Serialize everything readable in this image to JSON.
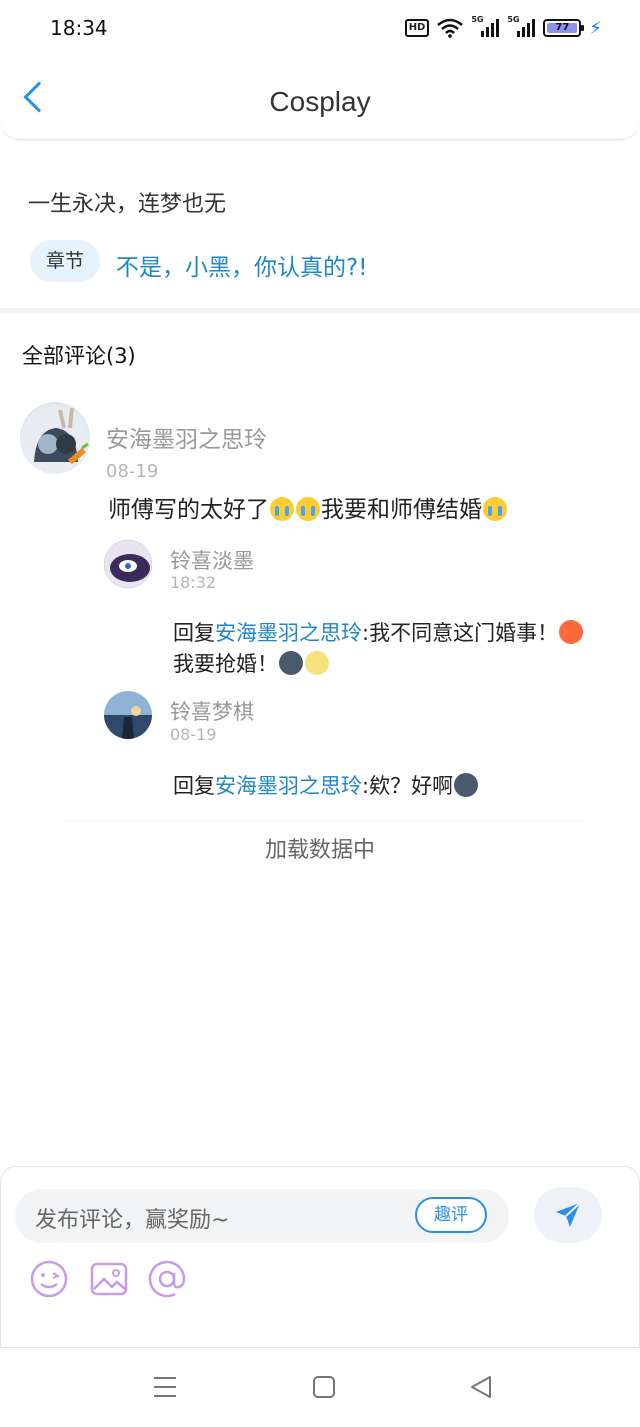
{
  "status_bar": {
    "time": "18:34",
    "hd_label": "HD",
    "signal_label": "5G",
    "battery": "77"
  },
  "header": {
    "title": "Cosplay"
  },
  "book": {
    "title": "一生永决，连梦也无",
    "chapter_tag": "章节",
    "chapter_name": "不是，小黑，你认真的?!"
  },
  "comments": {
    "heading": "全部评论(3)",
    "main": {
      "user": "安海墨羽之思玲",
      "date": "08-19",
      "text_part1": "师傅写的太好了",
      "text_part2": "我要和师傅结婚"
    },
    "replies": [
      {
        "user": "铃喜淡墨",
        "time": "18:32",
        "prefix": "回复",
        "target": "安海墨羽之思玲",
        "text_line1": ":我不同意这门婚事！",
        "text_line2": "我要抢婚！"
      },
      {
        "user": "铃喜梦棋",
        "time": "08-19",
        "prefix": "回复",
        "target": "安海墨羽之思玲",
        "text": ":欸？好啊"
      }
    ],
    "loading": "加载数据中"
  },
  "input": {
    "placeholder": "发布评论，赢奖励~",
    "quping_label": "趣评"
  },
  "colors": {
    "accent": "#2b8ee8",
    "link": "#1e88c7",
    "tag_bg": "#e6f3fc"
  }
}
